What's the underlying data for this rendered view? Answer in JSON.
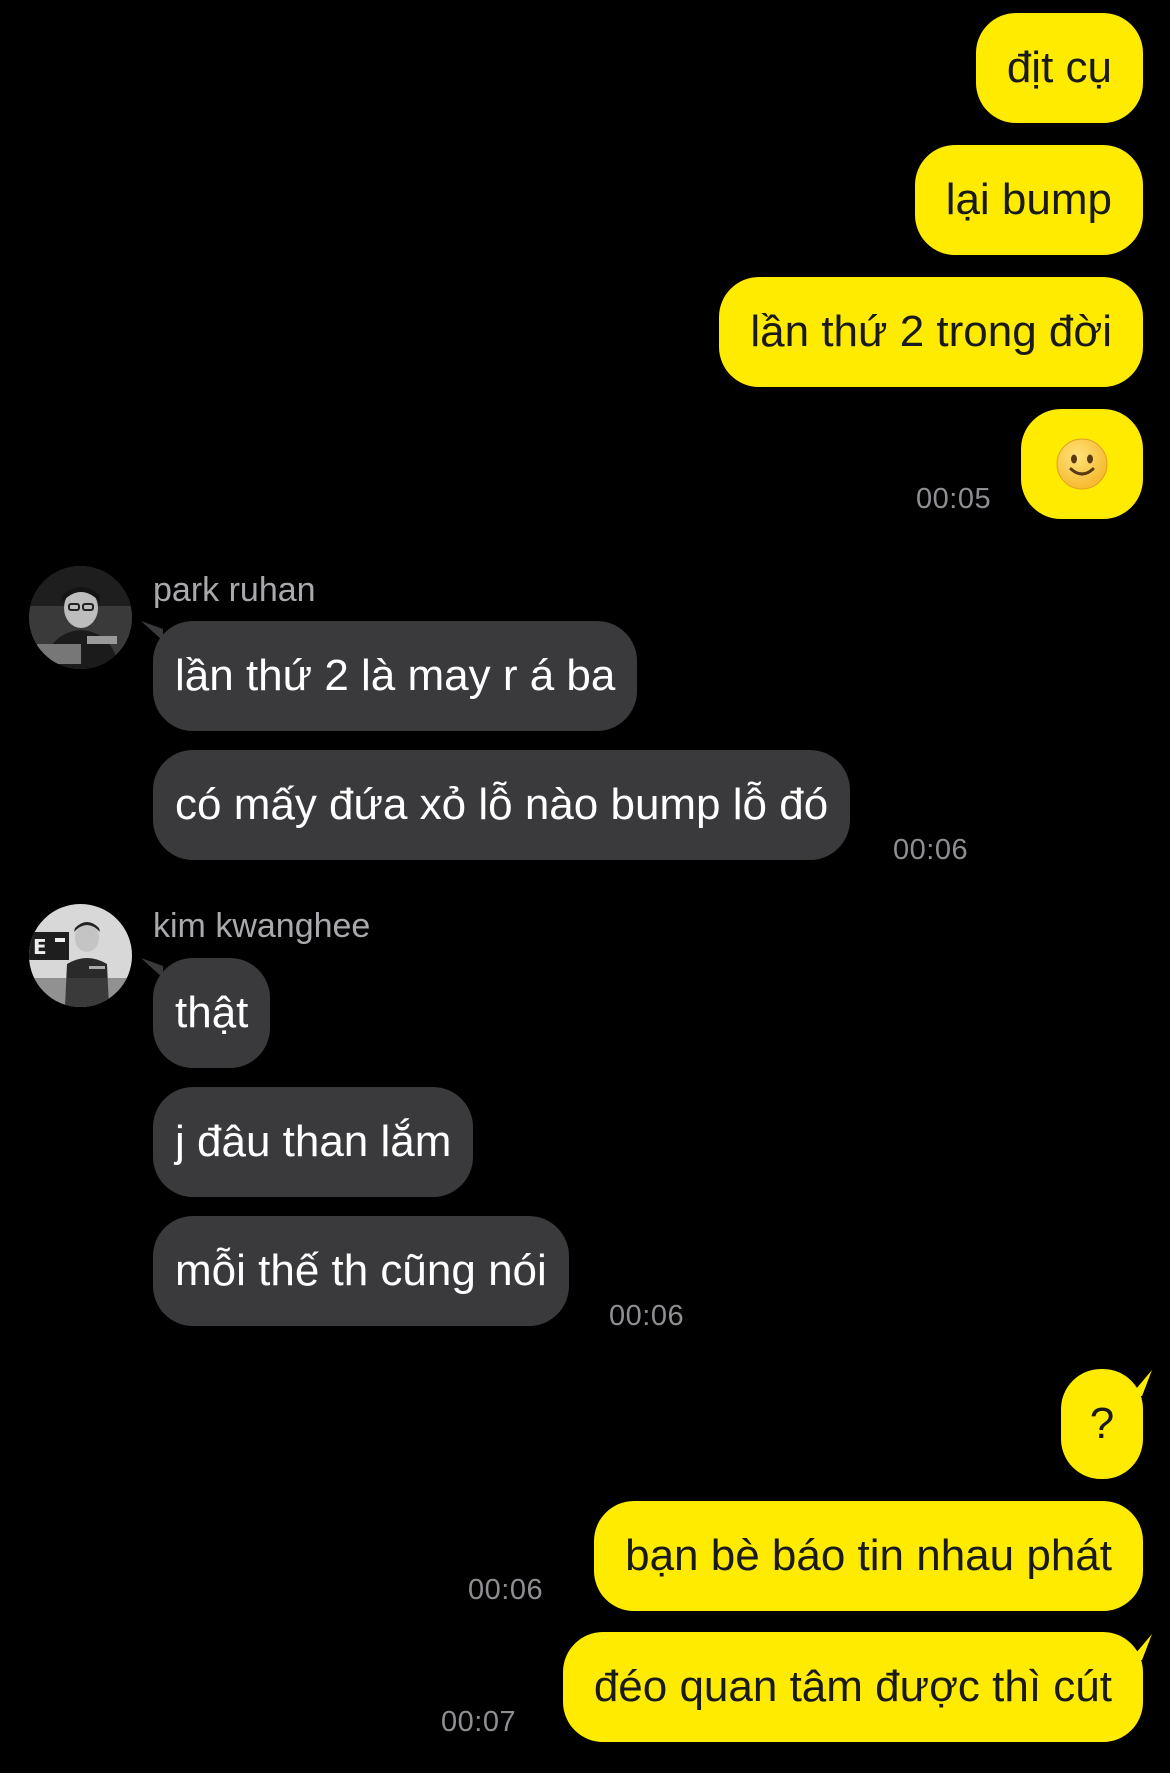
{
  "colors": {
    "background": "#000000",
    "my_bubble": "#FFEB00",
    "their_bubble": "#3a3a3c",
    "timestamp": "#8e8e93"
  },
  "block1": {
    "messages": [
      "địt cụ",
      "lại bump",
      "lần thứ 2 trong đời"
    ],
    "emoji": "slightly-smiling-face",
    "time": "00:05"
  },
  "block2": {
    "sender": "park ruhan",
    "messages": [
      "lần thứ 2 là may r á ba",
      "có mấy đứa xỏ lỗ nào bump lỗ đó"
    ],
    "time": "00:06"
  },
  "block3": {
    "sender": "kim kwanghee",
    "messages": [
      "thật",
      "j đâu than lắm",
      "mỗi thế th cũng nói"
    ],
    "time": "00:06"
  },
  "block4": {
    "messages": [
      "?",
      "bạn bè báo tin nhau phát",
      "đéo quan tâm được thì cút"
    ],
    "times": [
      "00:06",
      "00:07"
    ]
  }
}
